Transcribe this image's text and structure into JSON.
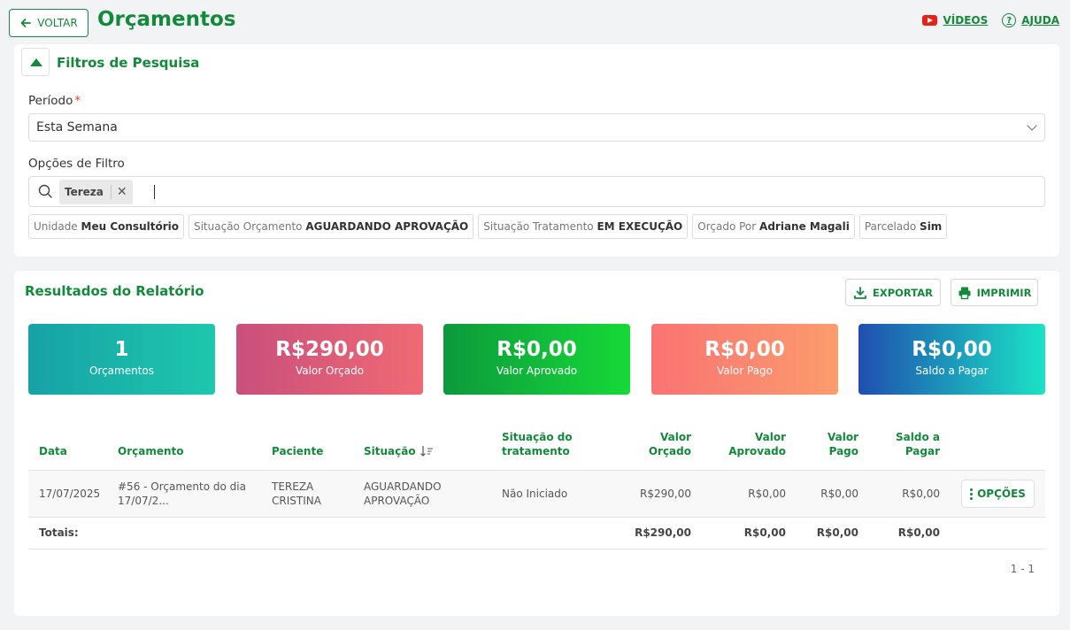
{
  "header": {
    "back_label": "VOLTAR",
    "title": "Orçamentos",
    "videos_label": "VÍDEOS",
    "help_label": "AJUDA"
  },
  "filters": {
    "title": "Filtros de Pesquisa",
    "period_label": "Período",
    "required_mark": "*",
    "period_value": "Esta Semana",
    "options_label": "Opções de Filtro",
    "chip": "Tereza",
    "tags": [
      {
        "key": "Unidade",
        "value": "Meu Consultório"
      },
      {
        "key": "Situação Orçamento",
        "value": "AGUARDANDO APROVAÇÃO"
      },
      {
        "key": "Situação Tratamento",
        "value": "EM EXECUÇÃO"
      },
      {
        "key": "Orçado Por",
        "value": "Adriane Magali"
      },
      {
        "key": "Parcelado",
        "value": "Sim"
      }
    ]
  },
  "results": {
    "title": "Resultados do Relatório",
    "export_label": "EXPORTAR",
    "print_label": "IMPRIMIR",
    "kpis": [
      {
        "value": "1",
        "label": "Orçamentos"
      },
      {
        "value": "R$290,00",
        "label": "Valor Orçado"
      },
      {
        "value": "R$0,00",
        "label": "Valor Aprovado"
      },
      {
        "value": "R$0,00",
        "label": "Valor Pago"
      },
      {
        "value": "R$0,00",
        "label": "Saldo a Pagar"
      }
    ],
    "columns": {
      "data": "Data",
      "orcamento": "Orçamento",
      "paciente": "Paciente",
      "situacao": "Situação",
      "sit_trat_1": "Situação do",
      "sit_trat_2": "tratamento",
      "orcado_1": "Valor",
      "orcado_2": "Orçado",
      "aprovado_1": "Valor",
      "aprovado_2": "Aprovado",
      "pago_1": "Valor",
      "pago_2": "Pago",
      "saldo_1": "Saldo a",
      "saldo_2": "Pagar"
    },
    "row": {
      "data": "17/07/2025",
      "orcamento_1": "#56 - Orçamento do dia",
      "orcamento_2": "17/07/2...",
      "paciente_1": "TEREZA",
      "paciente_2": "CRISTINA",
      "situacao_1": "AGUARDANDO",
      "situacao_2": "APROVAÇÃO",
      "sit_trat": "Não Iniciado",
      "orcado": "R$290,00",
      "aprovado": "R$0,00",
      "pago": "R$0,00",
      "saldo": "R$0,00",
      "options_label": "OPÇÕES"
    },
    "totals": {
      "label": "Totais:",
      "orcado": "R$290,00",
      "aprovado": "R$0,00",
      "pago": "R$0,00",
      "saldo": "R$0,00"
    },
    "pager": "1 - 1"
  },
  "colors": {
    "accent": "#13893a"
  }
}
